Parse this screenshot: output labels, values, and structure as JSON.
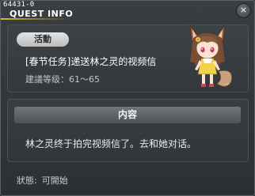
{
  "window": {
    "id": "64431-0",
    "title": "QUEST INFO",
    "close_glyph": "×"
  },
  "quest": {
    "category": "活動",
    "name": "[春节任务]递送林之灵的视频信",
    "level": "建議等级：61〜65",
    "npc_icon": "fox-girl-npc-portrait"
  },
  "content": {
    "header": "内容",
    "body": "林之灵终于拍完视频信了。去和她对话。"
  },
  "status": {
    "label": "狀態:",
    "value": "可開始"
  },
  "colors": {
    "accent": "#d2bf2a",
    "window_bg": "#2f3336",
    "panel_bg": "#3c4246"
  }
}
